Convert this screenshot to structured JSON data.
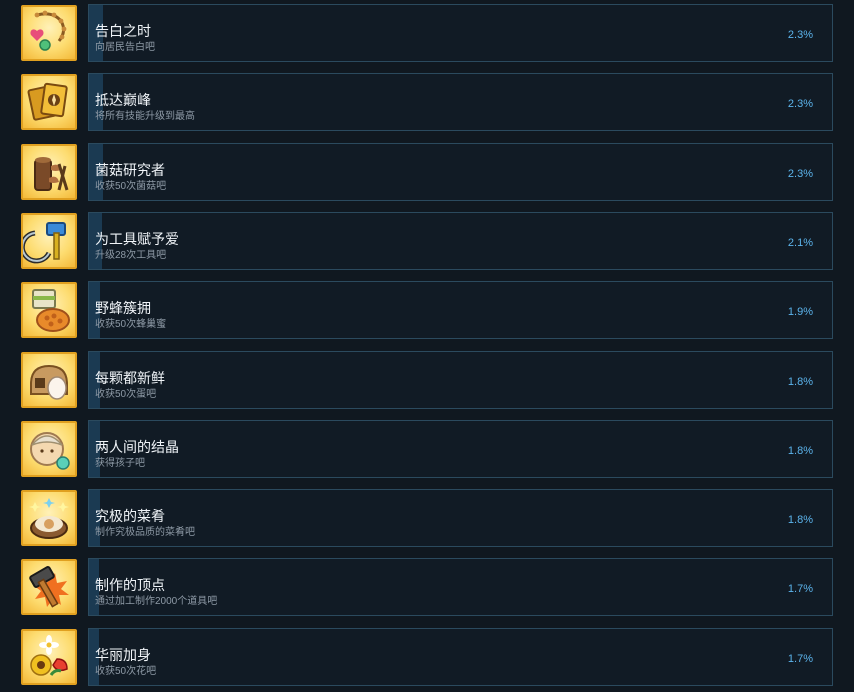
{
  "achievements": [
    {
      "title": "告白之时",
      "description": "向居民告白吧",
      "percent_text": "2.3%",
      "percent": 2.3,
      "icon": "necklace-icon"
    },
    {
      "title": "抵达巅峰",
      "description": "将所有技能升级到最高",
      "percent_text": "2.3%",
      "percent": 2.3,
      "icon": "skill-cards-icon"
    },
    {
      "title": "菌菇研究者",
      "description": "收获50次菌菇吧",
      "percent_text": "2.3%",
      "percent": 2.3,
      "icon": "mushroom-log-icon"
    },
    {
      "title": "为工具赋予爱",
      "description": "升级28次工具吧",
      "percent_text": "2.1%",
      "percent": 2.1,
      "icon": "hammer-sickle-icon"
    },
    {
      "title": "野蜂簇拥",
      "description": "收获50次蜂巢蜜",
      "percent_text": "1.9%",
      "percent": 1.9,
      "icon": "honeycomb-icon"
    },
    {
      "title": "每颗都新鲜",
      "description": "收获50次蛋吧",
      "percent_text": "1.8%",
      "percent": 1.8,
      "icon": "egg-icon"
    },
    {
      "title": "两人间的结晶",
      "description": "获得孩子吧",
      "percent_text": "1.8%",
      "percent": 1.8,
      "icon": "baby-icon"
    },
    {
      "title": "究极的菜肴",
      "description": "制作究极品质的菜肴吧",
      "percent_text": "1.8%",
      "percent": 1.8,
      "icon": "dish-icon"
    },
    {
      "title": "制作的顶点",
      "description": "通过加工制作2000个道具吧",
      "percent_text": "1.7%",
      "percent": 1.7,
      "icon": "crafting-hammer-icon"
    },
    {
      "title": "华丽加身",
      "description": "收获50次花吧",
      "percent_text": "1.7%",
      "percent": 1.7,
      "icon": "flower-icon"
    }
  ],
  "colors": {
    "background": "#101820",
    "row_border": "#2b4a5e",
    "progress_fill": "#1b3a52",
    "percent_text": "#5cb4ec",
    "title_text": "#f0f4f8",
    "description_text": "#8e9aa6",
    "icon_frame": "#e0a020"
  }
}
